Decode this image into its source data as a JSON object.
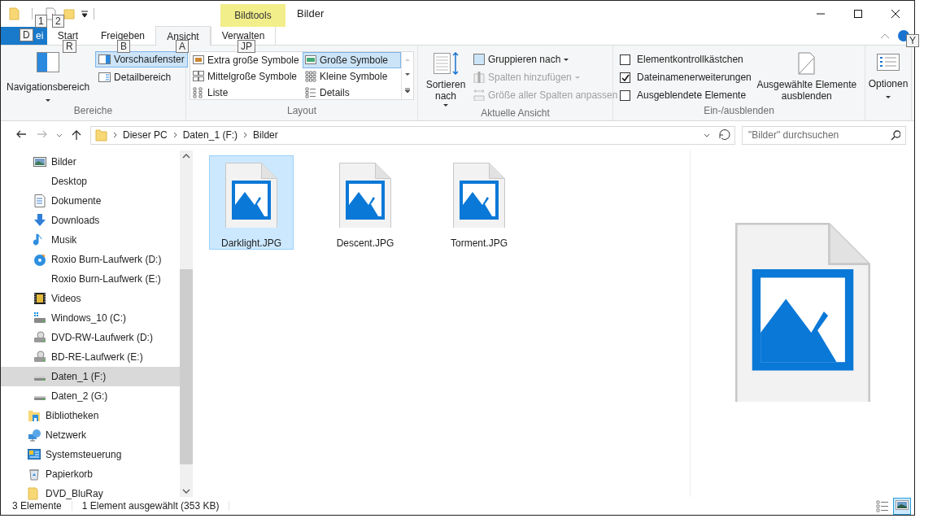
{
  "title_bar": {
    "keytips": [
      "1",
      "2"
    ],
    "context_label": "Bildtools",
    "title": "Bilder"
  },
  "tabs": [
    {
      "kind": "file",
      "label": "ei",
      "keytip": "D",
      "selected": false
    },
    {
      "kind": "tab",
      "label": "Start",
      "keytip": "R",
      "selected": false
    },
    {
      "kind": "tab",
      "label": "Freigeben",
      "keytip": "B",
      "selected": false
    },
    {
      "kind": "tab",
      "label": "Ansicht",
      "keytip": "A",
      "selected": true
    },
    {
      "kind": "tab",
      "label": "Verwalten",
      "keytip": "JP",
      "selected": false
    }
  ],
  "help_keytip": "Y",
  "ribbon": {
    "panes": {
      "label": "Bereiche",
      "navigation": "Navigationsbereich",
      "items": [
        {
          "label": "Vorschaufenster",
          "selected": true
        },
        {
          "label": "Detailbereich",
          "selected": false
        }
      ]
    },
    "layout": {
      "label": "Layout",
      "items": [
        {
          "label": "Extra große Symbole",
          "selected": false
        },
        {
          "label": "Große Symbole",
          "selected": true
        },
        {
          "label": "Mittelgroße Symbole",
          "selected": false
        },
        {
          "label": "Kleine Symbole",
          "selected": false
        },
        {
          "label": "Liste",
          "selected": false
        },
        {
          "label": "Details",
          "selected": false
        }
      ]
    },
    "current_view": {
      "label": "Aktuelle Ansicht",
      "sort_by": "Sortieren nach",
      "commands": [
        {
          "label": "Gruppieren nach",
          "disabled": false
        },
        {
          "label": "Spalten hinzufügen",
          "disabled": true
        },
        {
          "label": "Größe aller Spalten anpassen",
          "disabled": true
        }
      ]
    },
    "show_hide": {
      "label": "Ein-/ausblenden",
      "checkboxes": [
        {
          "label": "Elementkontrollkästchen",
          "checked": false
        },
        {
          "label": "Dateinamenerweiterungen",
          "checked": true
        },
        {
          "label": "Ausgeblendete Elemente",
          "checked": false
        }
      ],
      "hide_selected": "Ausgewählte Elemente ausblenden"
    },
    "options": "Optionen"
  },
  "address_bar": {
    "path": [
      "Dieser PC",
      "Daten_1 (F:)",
      "Bilder"
    ],
    "search_placeholder": "\"Bilder\" durchsuchen"
  },
  "sidebar": {
    "nested_items": [
      {
        "label": "Bilder",
        "kind": "pictures",
        "selected": false
      },
      {
        "label": "Desktop",
        "kind": "plain",
        "selected": false
      },
      {
        "label": "Dokumente",
        "kind": "documents",
        "selected": false
      },
      {
        "label": "Downloads",
        "kind": "downloads",
        "selected": false
      },
      {
        "label": "Musik",
        "kind": "music",
        "selected": false
      },
      {
        "label": "Roxio Burn-Laufwerk (D:)",
        "kind": "disc",
        "selected": false
      },
      {
        "label": "Roxio Burn-Laufwerk (E:)",
        "kind": "plain",
        "selected": false
      },
      {
        "label": "Videos",
        "kind": "videos",
        "selected": false
      },
      {
        "label": "Windows_10 (C:)",
        "kind": "windows_drive",
        "selected": false
      },
      {
        "label": "DVD-RW-Laufwerk (D:)",
        "kind": "optical_drive",
        "selected": false
      },
      {
        "label": "BD-RE-Laufwerk (E:)",
        "kind": "optical_drive",
        "selected": false
      },
      {
        "label": "Daten_1 (F:)",
        "kind": "drive",
        "selected": true
      },
      {
        "label": "Daten_2 (G:)",
        "kind": "drive",
        "selected": false
      }
    ],
    "items": [
      {
        "label": "Bibliotheken",
        "kind": "libraries",
        "selected": false
      },
      {
        "label": "Netzwerk",
        "kind": "network",
        "selected": false
      },
      {
        "label": "Systemsteuerung",
        "kind": "control_panel",
        "selected": false
      },
      {
        "label": "Papierkorb",
        "kind": "recycle_bin",
        "selected": false
      },
      {
        "label": "DVD_BluRay",
        "kind": "folder",
        "selected": false
      }
    ]
  },
  "files": [
    {
      "name": "Darklight.JPG",
      "selected": true
    },
    {
      "name": "Descent.JPG",
      "selected": false
    },
    {
      "name": "Torment.JPG",
      "selected": false
    }
  ],
  "status_bar": {
    "count": "3 Elemente",
    "selection": "1 Element ausgewählt (353 KB)",
    "views": [
      {
        "kind": "details",
        "selected": false
      },
      {
        "kind": "large_icons",
        "selected": true
      }
    ]
  }
}
